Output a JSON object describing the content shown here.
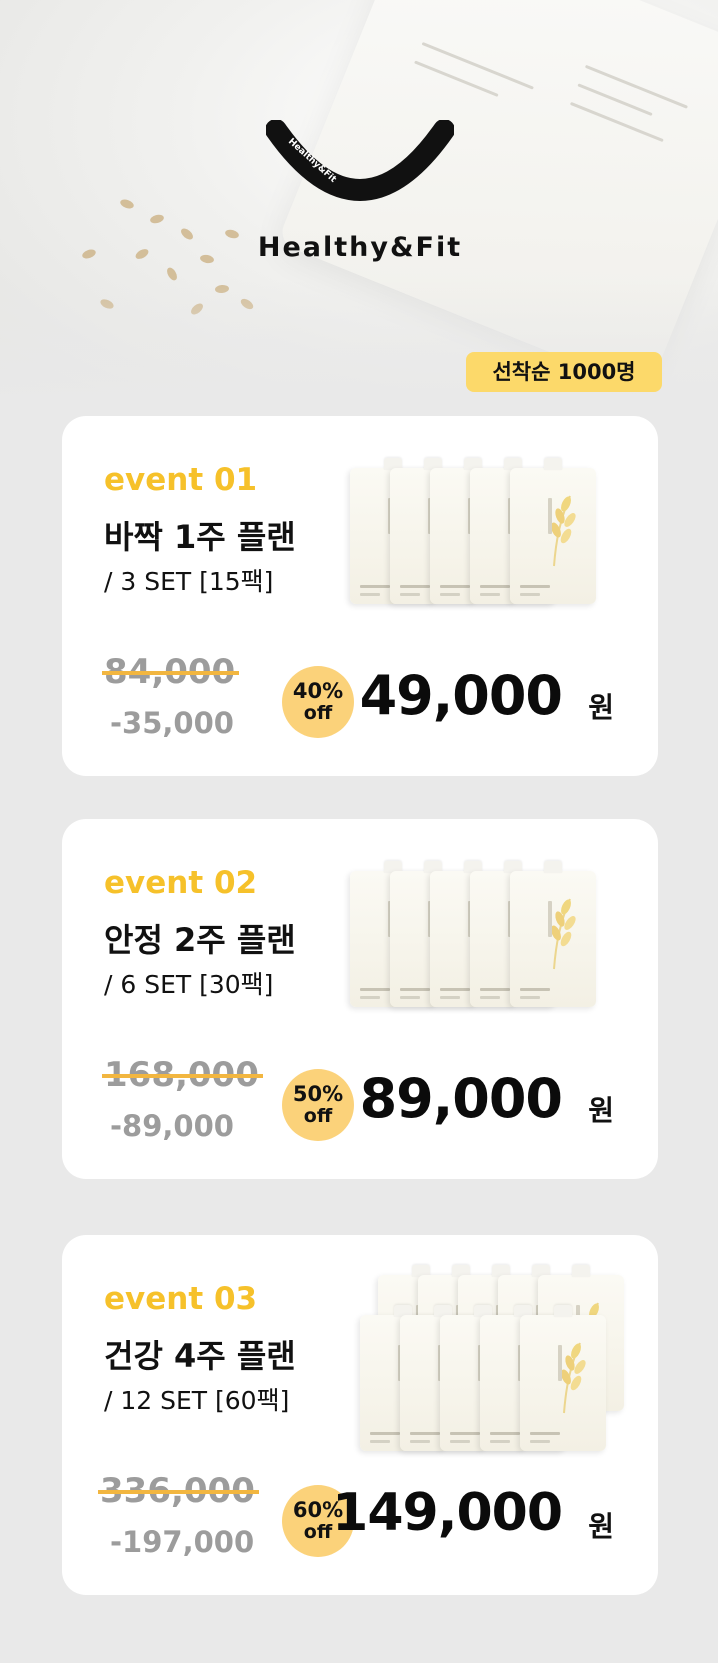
{
  "hero": {
    "brand": "Healthy&Fit",
    "badge_ring_text": "Healthy&Fit"
  },
  "first_come_badge": "선착순 1000명",
  "colors": {
    "accent_yellow": "#f6c12a",
    "badge_yellow": "#fcd96a",
    "off_circle": "#fbd27a",
    "strike": "#f2b640",
    "muted_price": "#9c9c9c"
  },
  "events": [
    {
      "label": "event 01",
      "title": "바짝 1주 플랜",
      "sets": "/ 3 SET [15팩]",
      "original_price": "84,000",
      "discount": "-35,000",
      "off_pct": "40%",
      "off_word": "off",
      "price": "49,000",
      "currency": "원",
      "pack_count": 5
    },
    {
      "label": "event 02",
      "title": "안정 2주 플랜",
      "sets": "/ 6 SET [30팩]",
      "original_price": "168,000",
      "discount": "-89,000",
      "off_pct": "50%",
      "off_word": "off",
      "price": "89,000",
      "currency": "원",
      "pack_count": 5
    },
    {
      "label": "event 03",
      "title": "건강 4주 플랜",
      "sets": "/ 12 SET [60팩]",
      "original_price": "336,000",
      "discount": "-197,000",
      "off_pct": "60%",
      "off_word": "off",
      "price": "149,000",
      "currency": "원",
      "pack_count": 10
    }
  ]
}
